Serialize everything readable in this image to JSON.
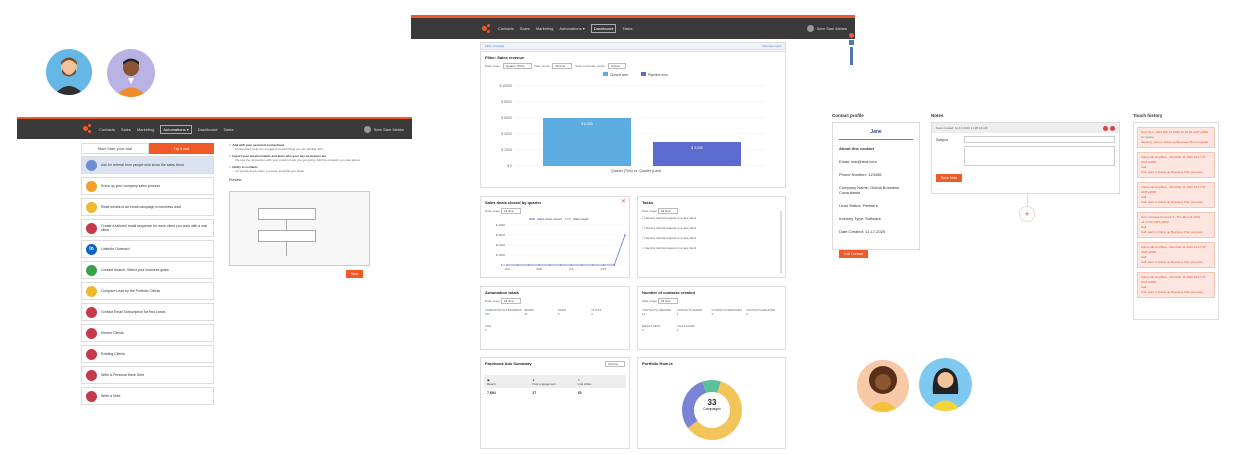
{
  "app": {
    "nav_items": [
      "Contacts",
      "Sales",
      "Marketing",
      "Automations ▾",
      "Dashboard",
      "Tasks"
    ],
    "user_name": "Sam Sam Melaw",
    "user_name_left": "Sam Sam Melaw"
  },
  "left_panel": {
    "tab_start": "Start Start your trial",
    "tab_active": "Try it out",
    "tasks": [
      "Ask for referral from people who know the sales trend",
      "Know up your company sales process",
      "Read emails in an email campaign to business lead",
      "Create a tailored email sequence for each client you work with a real client",
      "LinkedIn Outreach",
      "Contact Search: Select your business goals",
      "Compare Lead by the Portfolio Clients",
      "Contact Email Subscription for first Leads",
      "Recent Clients",
      "Existing Clients",
      "Write A Personal Have Sent",
      "Write a Note"
    ],
    "checks": [
      {
        "title": "Add with your personal connections",
        "desc": "Connections help you engage and add things you are familiar with."
      },
      {
        "title": "Import your email contacts and learn who your key customers are",
        "desc": "We use the connection with your email to help you get going. Add the contacts you care about."
      },
      {
        "title": "Notify to contacts",
        "desc": "Let people know when you have something to share."
      }
    ],
    "preview_label": "Preview",
    "next_button": "Next"
  },
  "dashboard": {
    "filter_link": "Filter (contact)",
    "filter_right": "Remove Card",
    "sales_title": "Filter: Sales revenue",
    "sales_filters": {
      "date_label": "Date range",
      "date_value": "Quarter (This)",
      "date_label2": "Date range",
      "date_value2": "All time",
      "compare_label": "Select compare option",
      "compare_value": "Actual"
    },
    "legend": [
      "Closed won",
      "Pipeline won"
    ],
    "bar_labels": [
      "$ 6,000",
      "$ 3,000"
    ],
    "xcat": "Quarter (This) vs. Quarter (Last)",
    "deals_title": "Sales deals closed by quarter",
    "deals_legend": [
      "Sales deals closed",
      "Sales deals"
    ],
    "deal_xlabels": [
      "JAN",
      "APR",
      "JUL",
      "OCT"
    ],
    "tasks_title": "Tasks",
    "tasks_list": [
      "Send a referral request to a new client",
      "Send a referral request to a new client",
      "Send a referral request to a new client",
      "Send a referral request to a new client"
    ],
    "automation_title": "Automation totals",
    "automation_stats": [
      {
        "label": "CAMPAIGNS IN PROGRESS",
        "value": "502"
      },
      {
        "label": "SENDS",
        "value": "26"
      },
      {
        "label": "OPEN",
        "value": "0"
      },
      {
        "label": "CLICKS",
        "value": "0"
      },
      {
        "label": "LIKE",
        "value": "0"
      }
    ],
    "contacts_title": "Number of contacts created",
    "contacts_stats": [
      {
        "label": "CONTACTS CREATED",
        "value": "12"
      },
      {
        "label": "CONTACTS ADDED",
        "value": "4"
      },
      {
        "label": "CONTACTS REMOVED",
        "value": "4"
      },
      {
        "label": "CONTACTS DELETED",
        "value": "0"
      },
      {
        "label": "EMAILS SENT",
        "value": "0"
      },
      {
        "label": "CALLS MADE",
        "value": "0"
      }
    ],
    "facebook_title": "Facebook Ads Summary",
    "facebook_select": "All time",
    "facebook_cols": [
      {
        "label": "Reach",
        "value": "7,894"
      },
      {
        "label": "Post engagement",
        "value": "27"
      },
      {
        "label": "Link clicks",
        "value": "35"
      }
    ],
    "portfolio_title": "Portfolio How-Is",
    "donut_value": "33",
    "donut_label": "Campaigns",
    "date_range_label": "Date range",
    "date_range_value": "All time"
  },
  "contact_profile": {
    "section_title": "Contact profile",
    "name": "Jane",
    "about": "About this contact",
    "email": "Email: test@test.com",
    "phone": "Phone Number: 123456",
    "company": "Company Name: Global Business Consultants",
    "lead_status": "Lead Status: Partners",
    "industry": "Industry Type: Software",
    "date": "Date Created: 11-17-2020",
    "button": "Call Contact"
  },
  "notes": {
    "section_title": "Notes",
    "header": "Date created: 11-17-2020 11:28:43 AM",
    "subject_label": "Subject",
    "save_button": "Save Note"
  },
  "touch": {
    "section_title": "Touch history",
    "items": [
      {
        "t1": "Next Text : Wed Mar 15 2020 10:25:23 GMT+0800",
        "t2": "Complete",
        "t3": "Meeting: want to follow up Business Plan proposal"
      },
      {
        "t1": "Voicemail dropBlue - Wed Mar 11 2020 14:17:00 GMT+0800",
        "t2": "Call",
        "t3": "Call: want to follow up Business Plan proposal"
      },
      {
        "t1": "Voicemail dropBlue - Wed Mar 11 2020 14:17:00 GMT+0800",
        "t2": "Call",
        "t3": "Call: want to follow up Business Plan proposal"
      },
      {
        "t1": "Text message Kenneth T - The Mon 11 2020 14:17:00 GMT+0800",
        "t2": "Call",
        "t3": "Call: want to follow up Business Plan proposal"
      },
      {
        "t1": "Voicemail dropBlue - Wed Mar 11 2020 14:17:00 GMT+0800",
        "t2": "Call",
        "t3": "Call: want to follow up Business Plan proposal"
      },
      {
        "t1": "Voicemail dropBlue - Wed Mar 11 2020 14:17:00 GMT+0800",
        "t2": "Call",
        "t3": "Call: want to follow up Business Plan proposal"
      }
    ]
  },
  "chart_data": [
    {
      "type": "bar",
      "title": "Filter: Sales revenue",
      "categories": [
        "Closed won",
        "Pipeline won"
      ],
      "values": [
        6000,
        3000
      ],
      "ylim": [
        0,
        10000
      ],
      "yticks": [
        "$ 10000",
        "$ 8000",
        "$ 6000",
        "$ 4000",
        "$ 2000",
        "$ 0"
      ],
      "colors": [
        "#5dade2",
        "#5b6bd0"
      ]
    },
    {
      "type": "line",
      "title": "Sales deals closed by quarter",
      "categories": [
        "JAN",
        "APR",
        "JUL",
        "OCT"
      ],
      "yticks": [
        "$ 4000",
        "$ 3000",
        "$ 2000",
        "$ 1000",
        "$ 0"
      ],
      "series": [
        {
          "name": "Sales deals closed",
          "values": [
            0,
            0,
            0,
            0,
            0,
            0,
            0,
            0,
            0,
            0,
            0,
            3000
          ]
        }
      ],
      "ylim": [
        0,
        4000
      ]
    },
    {
      "type": "pie",
      "title": "Portfolio How-Is",
      "values": [
        60,
        30,
        10
      ],
      "colors": [
        "#f3c45a",
        "#7b84d4",
        "#5bbf9b"
      ]
    }
  ]
}
